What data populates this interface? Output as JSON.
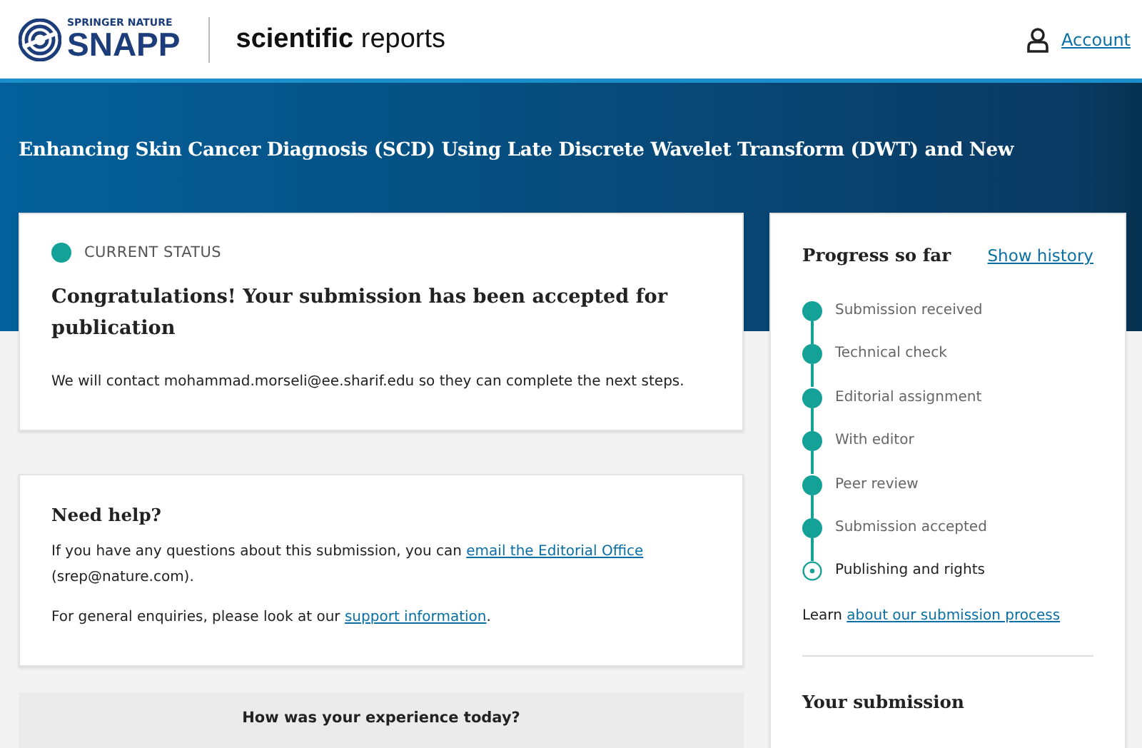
{
  "header": {
    "brand_top": "SPRINGER NATURE",
    "brand": "SNAPP",
    "journal": "**scientific** reports",
    "account": "Account"
  },
  "banner": {
    "title": "Enhancing Skin Cancer Diagnosis (SCD) Using Late Discrete Wavelet Transform (DWT) and New"
  },
  "status_card": {
    "label": "CURRENT STATUS",
    "color": "#14a198",
    "heading": "Congratulations! Your submission has been accepted for publication",
    "message": "We will contact mohammad.morseli@ee.sharif.edu so they can complete the next steps."
  },
  "help_card": {
    "heading": "Need help?",
    "paragraphs": [
      {
        "before": "If you have any questions about this submission, you can ",
        "link": "email the Editorial Office",
        "after": " (srep@nature.com)."
      },
      {
        "before": "For general enquiries, please look at our ",
        "link": "support information",
        "after": "."
      }
    ]
  },
  "feedback": {
    "heading": "How was your experience today?"
  },
  "progress": {
    "heading": "Progress so far",
    "history_link": "Show history",
    "steps": [
      {
        "label": "Submission received",
        "kind": "done"
      },
      {
        "label": "Technical check",
        "kind": "done"
      },
      {
        "label": "Editorial assignment",
        "kind": "done"
      },
      {
        "label": "With editor",
        "kind": "done"
      },
      {
        "label": "Peer review",
        "kind": "done"
      },
      {
        "label": "Submission accepted",
        "kind": "done"
      },
      {
        "label": "Publishing and rights",
        "kind": "current"
      }
    ],
    "learn": {
      "before": "Learn ",
      "link": "about our submission process"
    },
    "submission_heading": "Your submission"
  }
}
